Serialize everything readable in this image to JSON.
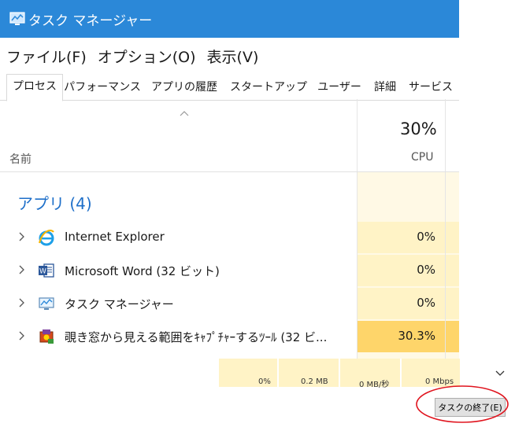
{
  "window": {
    "title": "タスク マネージャー"
  },
  "menu": [
    "ファイル(F)",
    "オプション(O)",
    "表示(V)"
  ],
  "tabs": [
    {
      "label": "プロセス",
      "active": true
    },
    {
      "label": "パフォーマンス"
    },
    {
      "label": "アプリの履歴"
    },
    {
      "label": "スタートアップ"
    },
    {
      "label": "ユーザー"
    },
    {
      "label": "詳細"
    },
    {
      "label": "サービス"
    }
  ],
  "header": {
    "cpu_total": "30%",
    "name_label": "名前",
    "cpu_label": "CPU"
  },
  "group": {
    "label": "アプリ (4)"
  },
  "processes": [
    {
      "name": "Internet Explorer",
      "icon": "internet-explorer-icon",
      "cpu": "0%"
    },
    {
      "name": "Microsoft Word (32 ビット)",
      "icon": "word-icon",
      "cpu": "0%"
    },
    {
      "name": "タスク マネージャー",
      "icon": "task-manager-icon",
      "cpu": "0%"
    },
    {
      "name": "覗き窓から見える範囲をｷｬﾌﾟﾁｬｰするﾂｰﾙ (32 ビ...",
      "icon": "capture-tool-icon",
      "cpu": "30.3%"
    }
  ],
  "background": {
    "row_values": [
      "0%",
      "0.2 MB",
      "0 MB/秒",
      "0 Mbps"
    ]
  },
  "end_task_button": "タスクの終了(E)",
  "colors": {
    "titlebar": "#2b88d8",
    "cpu_cell": "#fff3c6",
    "cpu_hot": "#fed56a",
    "group_blue": "#1e6fc9",
    "annotation": "#e0141e"
  }
}
